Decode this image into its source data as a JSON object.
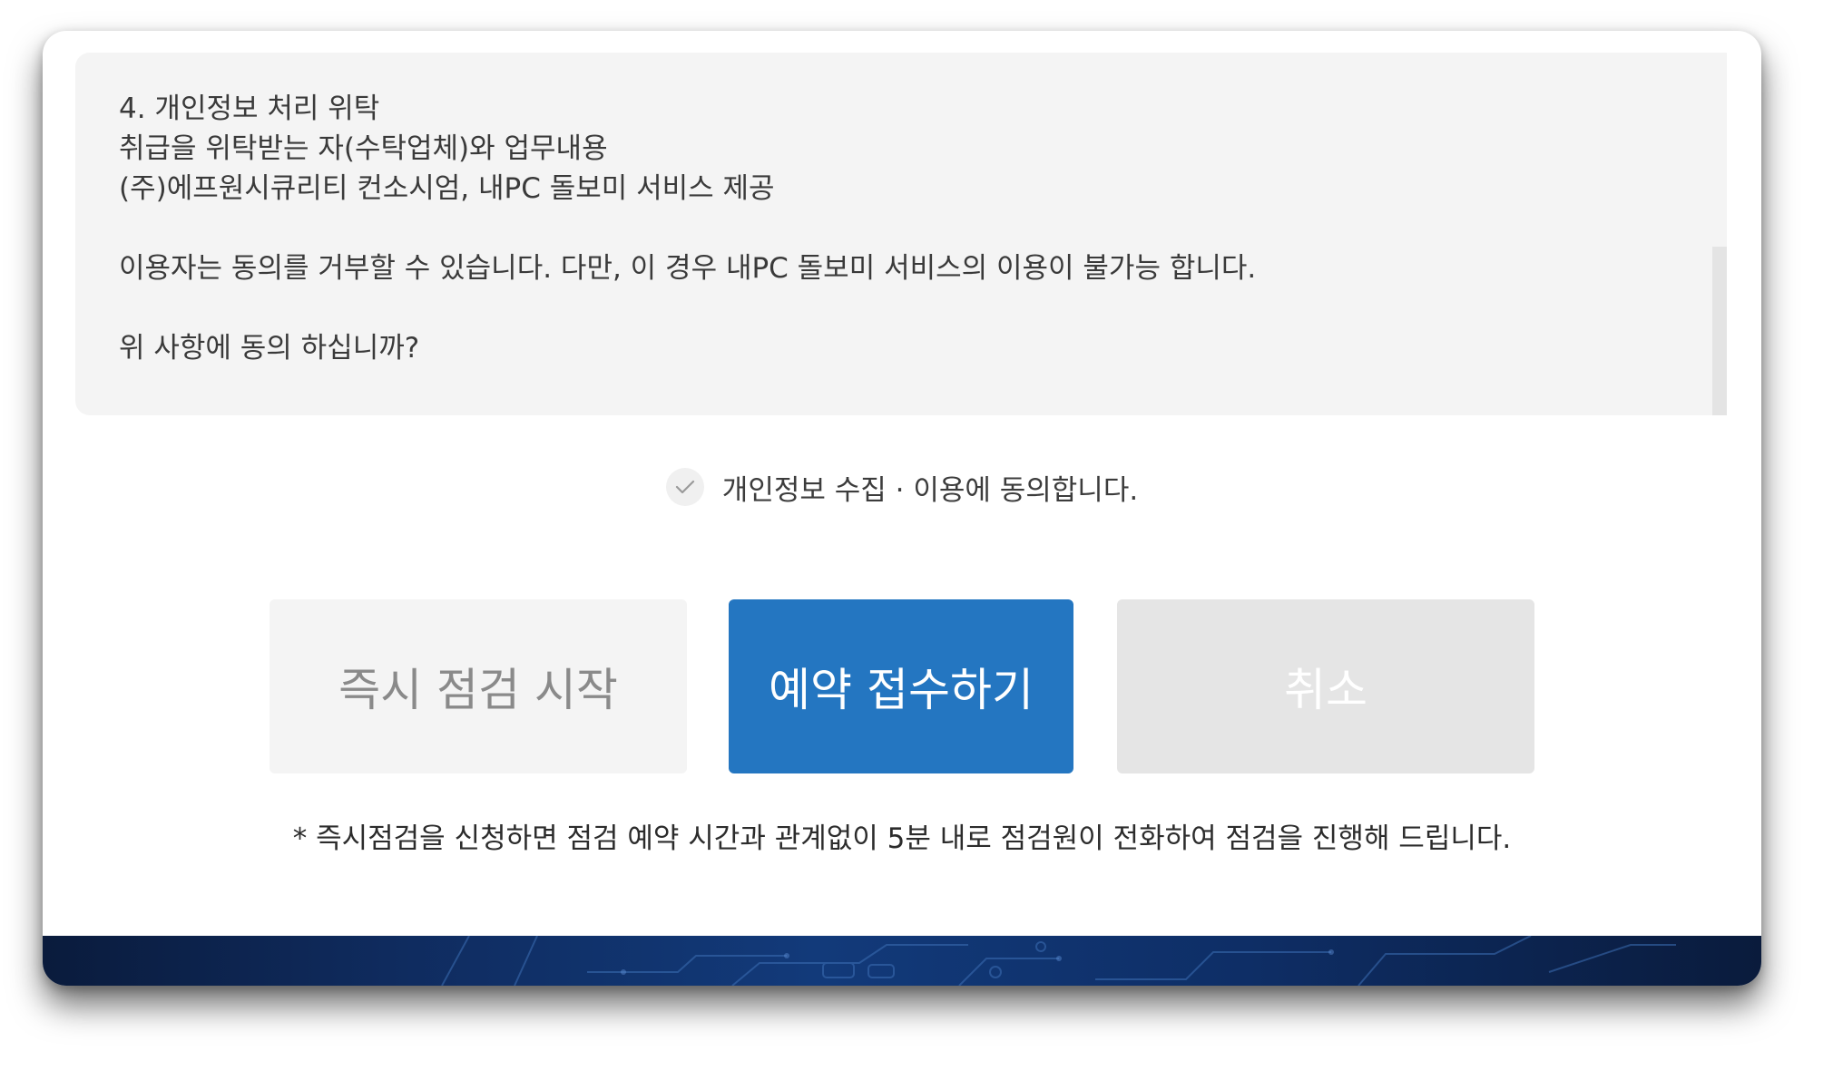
{
  "terms": {
    "line1": "4. 개인정보 처리 위탁",
    "line2": "취급을 위탁받는 자(수탁업체)와 업무내용",
    "line3": "(주)에프원시큐리티 컨소시엄, 내PC 돌보미 서비스 제공",
    "line4": "이용자는 동의를 거부할 수 있습니다. 다만, 이 경우 내PC 돌보미 서비스의 이용이 불가능 합니다.",
    "line5": "위 사항에 동의 하십니까?"
  },
  "agreement": {
    "label": "개인정보 수집 · 이용에 동의합니다.",
    "checked": false,
    "icon": "checkmark-icon"
  },
  "buttons": {
    "instant": "즉시 점검 시작",
    "reserve": "예약 접수하기",
    "cancel": "취소"
  },
  "note": "* 즉시점검을 신청하면 점검 예약 시간과 관계없이 5분 내로 점검원이 전화하여 점검을 진행해 드립니다.",
  "colors": {
    "primary": "#2476c1",
    "disabled_bg": "#e5e5e5",
    "light_bg": "#f4f4f4",
    "banner": "#0f2b5e"
  }
}
